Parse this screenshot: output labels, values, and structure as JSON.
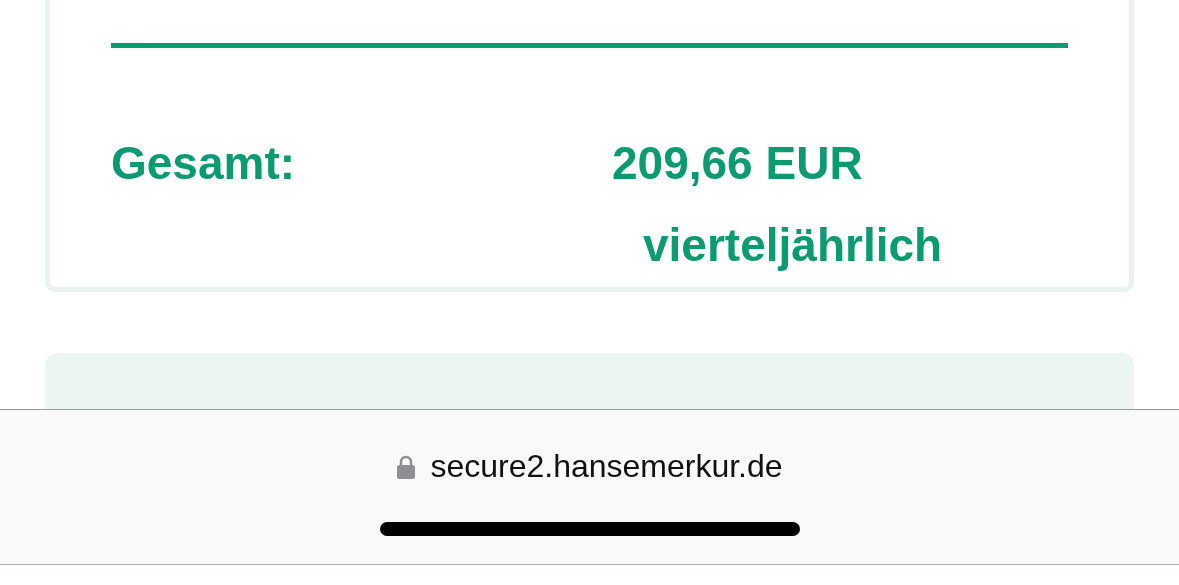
{
  "summary": {
    "label": "Gesamt:",
    "amount": "209,66 EUR",
    "period": "vierteljährlich"
  },
  "address_bar": {
    "url": "secure2.hansemerkur.de",
    "secure": true
  }
}
